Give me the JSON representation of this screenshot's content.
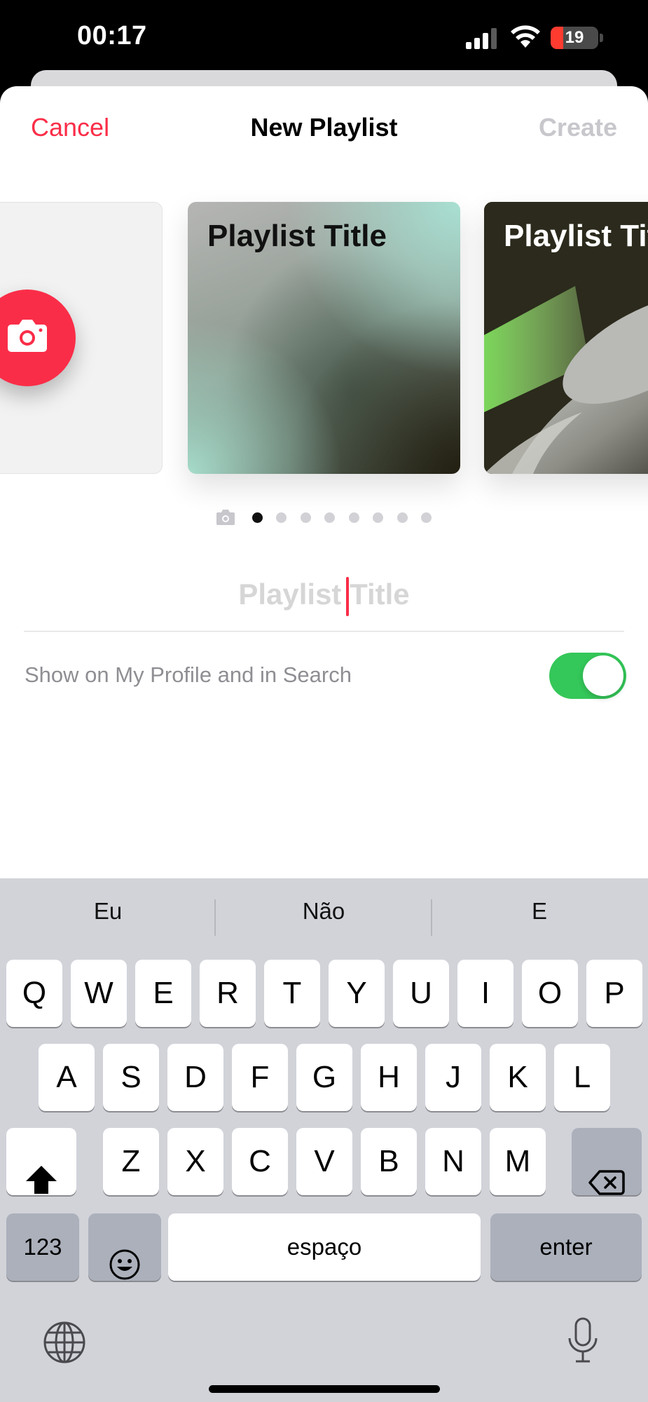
{
  "status_bar": {
    "time": "00:17",
    "battery": "19"
  },
  "nav": {
    "cancel": "Cancel",
    "title": "New Playlist",
    "create": "Create"
  },
  "carousel": {
    "cards": [
      {
        "title": "Playlist Title"
      },
      {
        "title": "Playlist Title"
      }
    ],
    "page_count": 8,
    "active_page": 1
  },
  "title_field": {
    "placeholder": "Playlist Title",
    "value": ""
  },
  "profile_toggle": {
    "label": "Show on My Profile and in Search",
    "on": true
  },
  "keyboard": {
    "suggestions": [
      "Eu",
      "Não",
      "E"
    ],
    "row1": [
      "Q",
      "W",
      "E",
      "R",
      "T",
      "Y",
      "U",
      "I",
      "O",
      "P"
    ],
    "row2": [
      "A",
      "S",
      "D",
      "F",
      "G",
      "H",
      "J",
      "K",
      "L"
    ],
    "row3": [
      "Z",
      "X",
      "C",
      "V",
      "B",
      "N",
      "M"
    ],
    "numbers_key": "123",
    "space_key": "espaço",
    "enter_key": "enter"
  },
  "colors": {
    "accent": "#fa2d48",
    "toggle_on": "#34c759"
  },
  "icons": [
    "camera-icon",
    "globe-icon",
    "microphone-icon",
    "shift-icon",
    "backspace-icon",
    "emoji-icon"
  ]
}
